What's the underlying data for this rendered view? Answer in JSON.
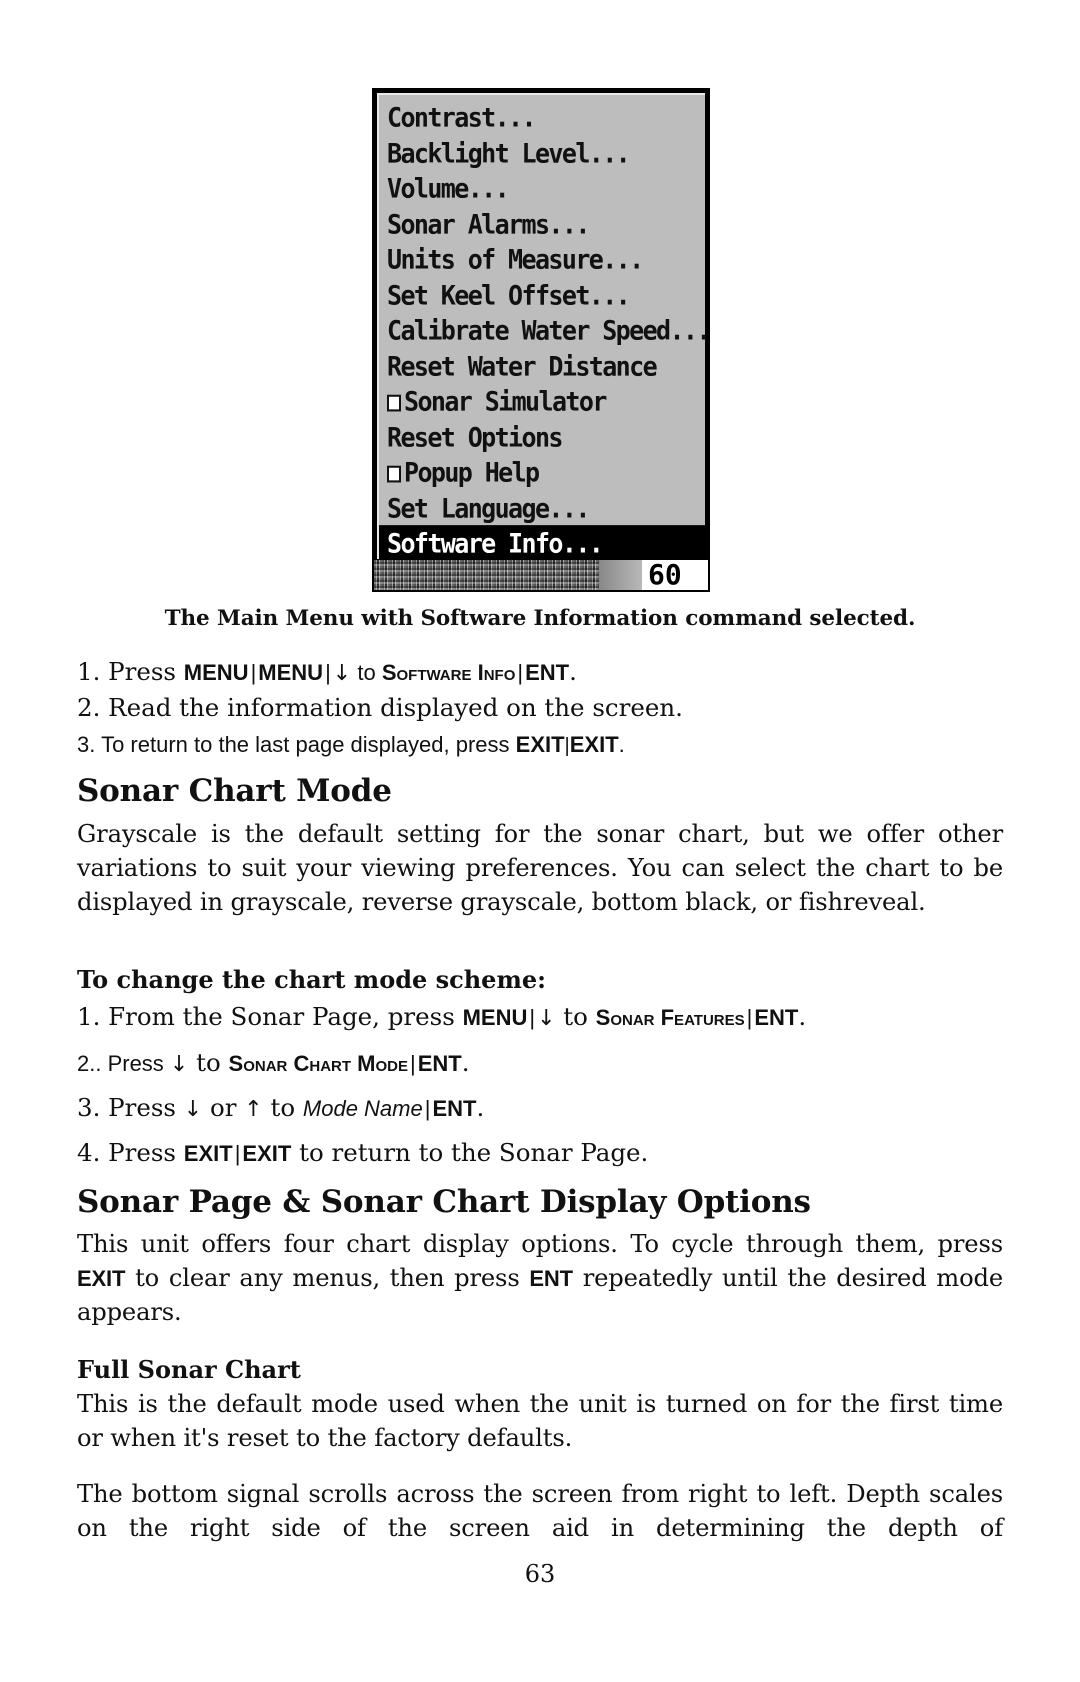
{
  "menu": {
    "items": [
      {
        "label": "Contrast...",
        "checkbox": false,
        "selected": false
      },
      {
        "label": "Backlight Level...",
        "checkbox": false,
        "selected": false
      },
      {
        "label": "Volume...",
        "checkbox": false,
        "selected": false
      },
      {
        "label": "Sonar Alarms...",
        "checkbox": false,
        "selected": false
      },
      {
        "label": "Units of Measure...",
        "checkbox": false,
        "selected": false
      },
      {
        "label": "Set Keel Offset...",
        "checkbox": false,
        "selected": false
      },
      {
        "label": "Calibrate Water Speed...",
        "checkbox": false,
        "selected": false
      },
      {
        "label": "Reset Water Distance",
        "checkbox": false,
        "selected": false
      },
      {
        "label": "Sonar Simulator",
        "checkbox": true,
        "checked": false,
        "selected": false
      },
      {
        "label": "Reset Options",
        "checkbox": false,
        "selected": false
      },
      {
        "label": "Popup Help",
        "checkbox": true,
        "checked": false,
        "selected": false
      },
      {
        "label": "Set Language...",
        "checkbox": false,
        "selected": false
      },
      {
        "label": "Software Info...",
        "checkbox": false,
        "selected": true
      }
    ],
    "status_readout": "60"
  },
  "caption": "The Main Menu with Software Information command selected.",
  "steps_software_info": {
    "s1": {
      "num": "1. Press ",
      "k1": "MENU",
      "sep1": "|",
      "k2": "MENU",
      "sep2": "|",
      "arrow": "↓",
      "to": " to ",
      "target": "Software Info",
      "sep3": "|",
      "k3": "ENT",
      "end": "."
    },
    "s2": {
      "text": "2. Read the information displayed on the screen."
    },
    "s3": {
      "text": "3. To return to the last page displayed, press ",
      "k1": "EXIT",
      "sep": "|",
      "k2": "EXIT",
      "end": "."
    }
  },
  "section_chart_mode": {
    "heading": "Sonar Chart Mode",
    "paragraph": "Grayscale is the default setting for the sonar chart, but we offer other variations to suit your viewing preferences. You can select the chart to be displayed in grayscale, reverse grayscale, bottom black, or fishreveal.",
    "subheading": "To change the chart mode scheme:",
    "steps": {
      "s1": {
        "num": "1. From the Sonar Page, press ",
        "k1": "MENU",
        "sep1": "|",
        "arrow": "↓",
        "to": " to ",
        "target": "Sonar Features",
        "sep2": "|",
        "k2": "ENT",
        "end": "."
      },
      "s2": {
        "num": "2.. Press ",
        "arrow": "↓",
        "to": " to ",
        "target": "Sonar Chart Mode",
        "sep": "|",
        "k1": "ENT",
        "end": "."
      },
      "s3": {
        "num": "3. Press ",
        "arrow_down": "↓",
        "or": " or ",
        "arrow_up": "↑",
        "to": " to ",
        "target": "Mode Name",
        "sep": "|",
        "k1": "ENT",
        "end": "."
      },
      "s4": {
        "num": "4. Press ",
        "k1": "EXIT",
        "sep": "|",
        "k2": "EXIT",
        "rest": " to return to the Sonar Page."
      }
    }
  },
  "section_display_options": {
    "heading": "Sonar Page & Sonar Chart Display Options",
    "p1_start": "This unit offers four chart display options. To cycle through them, press ",
    "p1_key1": "EXIT",
    "p1_mid": " to clear any menus, then press ",
    "p1_key2": "ENT",
    "p1_end": " repeatedly until the desired mode appears.",
    "subheading": "Full Sonar Chart",
    "p2": "This is the default mode used when the unit is turned on for the first time or when it's reset to the factory defaults.",
    "p3": "The bottom signal scrolls across the screen from right to left. Depth scales on the right side of the screen aid in determining the depth of"
  },
  "page_number": "63"
}
